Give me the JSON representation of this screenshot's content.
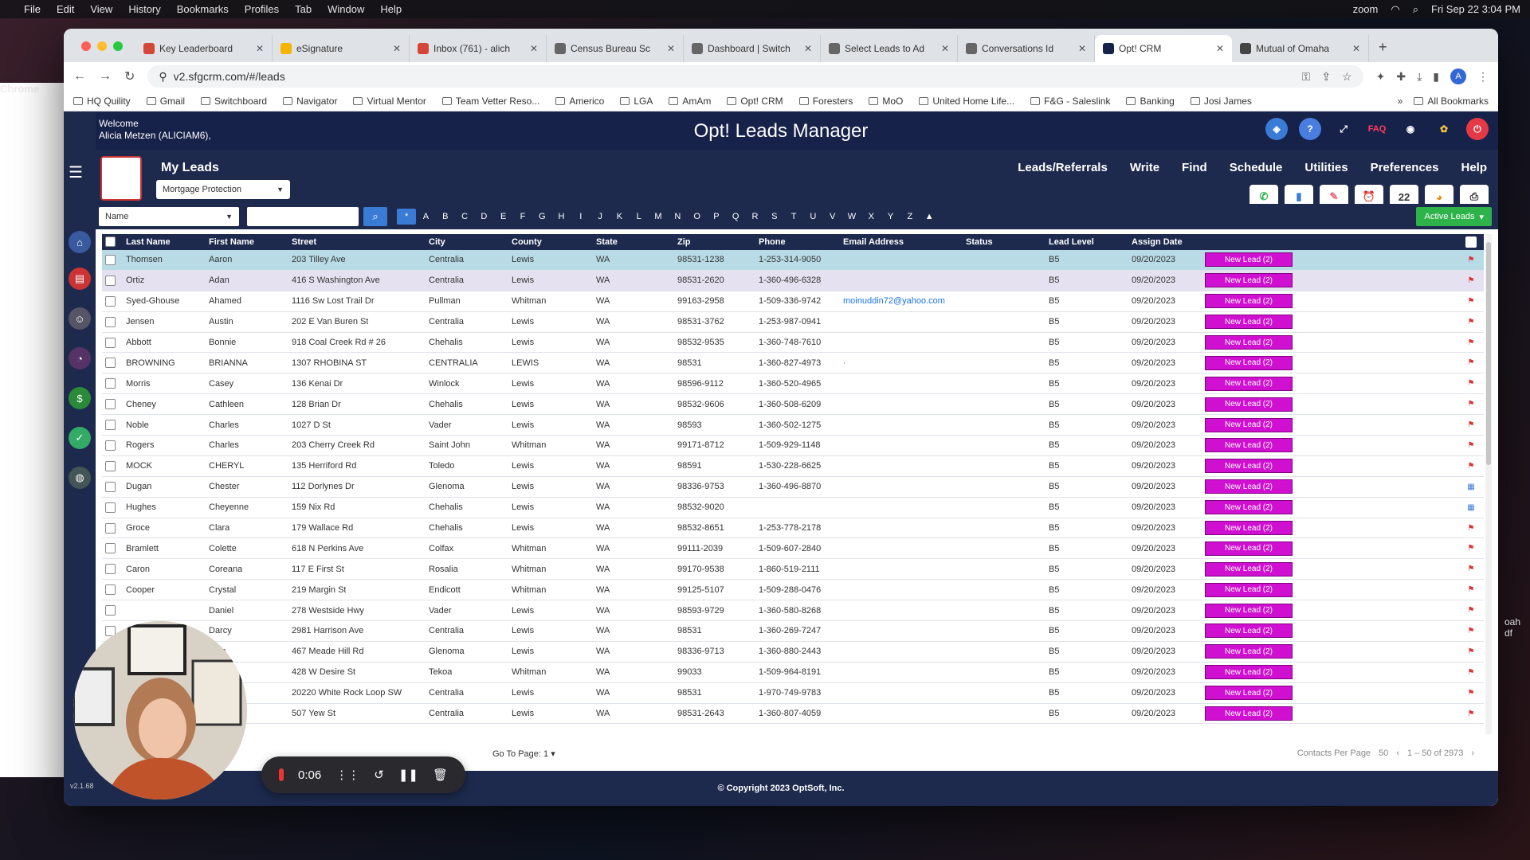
{
  "macos": {
    "app": "Chrome",
    "menu": [
      "File",
      "Edit",
      "View",
      "History",
      "Bookmarks",
      "Profiles",
      "Tab",
      "Window",
      "Help"
    ],
    "right": {
      "zoom": "zoom",
      "datetime": "Fri Sep 22  3:04 PM"
    }
  },
  "browser": {
    "tabs": [
      {
        "title": "Key Leaderboard",
        "fav": "gmail-icon",
        "color": "#d44638"
      },
      {
        "title": "eSignature",
        "fav": "doc-icon",
        "color": "#f4b400"
      },
      {
        "title": "Inbox (761) - alich",
        "fav": "gmail-icon",
        "color": "#d44638"
      },
      {
        "title": "Census Bureau Sc",
        "fav": "globe-icon",
        "color": "#666666"
      },
      {
        "title": "Dashboard | Switch",
        "fav": "globe-icon",
        "color": "#666666"
      },
      {
        "title": "Select Leads to Ad",
        "fav": "globe-icon",
        "color": "#666666"
      },
      {
        "title": "Conversations Id",
        "fav": "globe-icon",
        "color": "#666666"
      },
      {
        "title": "Opt! CRM",
        "fav": "optcrm-icon",
        "color": "#17224a",
        "active": true
      },
      {
        "title": "Mutual of Omaha",
        "fav": "globe-icon",
        "color": "#444444"
      }
    ],
    "url": "v2.sfgcrm.com/#/leads",
    "bookmarks": [
      "HQ Quility",
      "Gmail",
      "Switchboard",
      "Navigator",
      "Virtual Mentor",
      "Team Vetter Reso...",
      "Americo",
      "LGA",
      "AmAm",
      "Opt! CRM",
      "Foresters",
      "MoO",
      "United Home Life...",
      "F&G - Saleslink",
      "Banking",
      "Josi James"
    ],
    "all_bookmarks": "All Bookmarks"
  },
  "app": {
    "welcome_line1": "Welcome",
    "welcome_line2": "Alicia Metzen (ALICIAM6),",
    "title": "Opt! Leads Manager",
    "section_title": "My Leads",
    "lead_type": "Mortgage Protection",
    "nav": [
      "Leads/Referrals",
      "Write",
      "Find",
      "Schedule",
      "Utilities",
      "Preferences",
      "Help"
    ],
    "header_icons": [
      "map-icon",
      "help-icon",
      "fullscreen-icon",
      "faq-icon",
      "camera-icon",
      "flower-icon",
      "power-icon"
    ],
    "faq_label": "FAQ",
    "calendar_day": "22",
    "search_field": "Name",
    "alphabet": [
      "*",
      "A",
      "B",
      "C",
      "D",
      "E",
      "F",
      "G",
      "H",
      "I",
      "J",
      "K",
      "L",
      "M",
      "N",
      "O",
      "P",
      "Q",
      "R",
      "S",
      "T",
      "U",
      "V",
      "W",
      "X",
      "Y",
      "Z",
      "▲"
    ],
    "active_leads": "Active Leads",
    "columns": [
      "Last Name",
      "First Name",
      "Street",
      "City",
      "County",
      "State",
      "Zip",
      "Phone",
      "Email Address",
      "Status",
      "Lead Level",
      "Assign Date"
    ],
    "rows": [
      [
        "Thomsen",
        "Aaron",
        "203 Tilley Ave",
        "Centralia",
        "Lewis",
        "WA",
        "98531-1238",
        "1-253-314-9050",
        "",
        "New Lead (2)",
        "B5",
        "09/20/2023"
      ],
      [
        "Ortiz",
        "Adan",
        "416 S Washington Ave",
        "Centralia",
        "Lewis",
        "WA",
        "98531-2620",
        "1-360-496-6328",
        "",
        "New Lead (2)",
        "B5",
        "09/20/2023"
      ],
      [
        "Syed-Ghouse",
        "Ahamed",
        "1116 Sw Lost Trail Dr",
        "Pullman",
        "Whitman",
        "WA",
        "99163-2958",
        "1-509-336-9742",
        "moinuddin72@yahoo.com",
        "New Lead (2)",
        "B5",
        "09/20/2023"
      ],
      [
        "Jensen",
        "Austin",
        "202 E Van Buren St",
        "Centralia",
        "Lewis",
        "WA",
        "98531-3762",
        "1-253-987-0941",
        "",
        "New Lead (2)",
        "B5",
        "09/20/2023"
      ],
      [
        "Abbott",
        "Bonnie",
        "918 Coal Creek Rd # 26",
        "Chehalis",
        "Lewis",
        "WA",
        "98532-9535",
        "1-360-748-7610",
        "",
        "New Lead (2)",
        "B5",
        "09/20/2023"
      ],
      [
        "BROWNING",
        "BRIANNA",
        "1307 RHOBINA ST",
        "CENTRALIA",
        "LEWIS",
        "WA",
        "98531",
        "1-360-827-4973",
        "·",
        "New Lead (2)",
        "B5",
        "09/20/2023"
      ],
      [
        "Morris",
        "Casey",
        "136 Kenai Dr",
        "Winlock",
        "Lewis",
        "WA",
        "98596-9112",
        "1-360-520-4965",
        "",
        "New Lead (2)",
        "B5",
        "09/20/2023"
      ],
      [
        "Cheney",
        "Cathleen",
        "128 Brian Dr",
        "Chehalis",
        "Lewis",
        "WA",
        "98532-9606",
        "1-360-508-6209",
        "",
        "New Lead (2)",
        "B5",
        "09/20/2023"
      ],
      [
        "Noble",
        "Charles",
        "1027 D St",
        "Vader",
        "Lewis",
        "WA",
        "98593",
        "1-360-502-1275",
        "",
        "New Lead (2)",
        "B5",
        "09/20/2023"
      ],
      [
        "Rogers",
        "Charles",
        "203 Cherry Creek Rd",
        "Saint John",
        "Whitman",
        "WA",
        "99171-8712",
        "1-509-929-1148",
        "",
        "New Lead (2)",
        "B5",
        "09/20/2023"
      ],
      [
        "MOCK",
        "CHERYL",
        "135 Herriford Rd",
        "Toledo",
        "Lewis",
        "WA",
        "98591",
        "1-530-228-6625",
        "",
        "New Lead (2)",
        "B5",
        "09/20/2023"
      ],
      [
        "Dugan",
        "Chester",
        "112 Dorlynes Dr",
        "Glenoma",
        "Lewis",
        "WA",
        "98336-9753",
        "1-360-496-8870",
        "",
        "New Lead (2)",
        "B5",
        "09/20/2023"
      ],
      [
        "Hughes",
        "Cheyenne",
        "159 Nix Rd",
        "Chehalis",
        "Lewis",
        "WA",
        "98532-9020",
        "",
        "",
        "New Lead (2)",
        "B5",
        "09/20/2023"
      ],
      [
        "Groce",
        "Clara",
        "179 Wallace Rd",
        "Chehalis",
        "Lewis",
        "WA",
        "98532-8651",
        "1-253-778-2178",
        "",
        "New Lead (2)",
        "B5",
        "09/20/2023"
      ],
      [
        "Bramlett",
        "Colette",
        "618 N Perkins Ave",
        "Colfax",
        "Whitman",
        "WA",
        "99111-2039",
        "1-509-607-2840",
        "",
        "New Lead (2)",
        "B5",
        "09/20/2023"
      ],
      [
        "Caron",
        "Coreana",
        "117 E First St",
        "Rosalia",
        "Whitman",
        "WA",
        "99170-9538",
        "1-860-519-2111",
        "",
        "New Lead (2)",
        "B5",
        "09/20/2023"
      ],
      [
        "Cooper",
        "Crystal",
        "219 Margin St",
        "Endicott",
        "Whitman",
        "WA",
        "99125-5107",
        "1-509-288-0476",
        "",
        "New Lead (2)",
        "B5",
        "09/20/2023"
      ],
      [
        "",
        "Daniel",
        "278 Westside Hwy",
        "Vader",
        "Lewis",
        "WA",
        "98593-9729",
        "1-360-580-8268",
        "",
        "New Lead (2)",
        "B5",
        "09/20/2023"
      ],
      [
        "",
        "Darcy",
        "2981 Harrison Ave",
        "Centralia",
        "Lewis",
        "WA",
        "98531",
        "1-360-269-7247",
        "",
        "New Lead (2)",
        "B5",
        "09/20/2023"
      ],
      [
        "",
        "aryn",
        "467 Meade Hill Rd",
        "Glenoma",
        "Lewis",
        "WA",
        "98336-9713",
        "1-360-880-2443",
        "",
        "New Lead (2)",
        "B5",
        "09/20/2023"
      ],
      [
        "",
        "vid",
        "428 W Desire St",
        "Tekoa",
        "Whitman",
        "WA",
        "99033",
        "1-509-964-8191",
        "",
        "New Lead (2)",
        "B5",
        "09/20/2023"
      ],
      [
        "",
        "vid",
        "20220 White Rock Loop SW",
        "Centralia",
        "Lewis",
        "WA",
        "98531",
        "1-970-749-9783",
        "",
        "New Lead (2)",
        "B5",
        "09/20/2023"
      ],
      [
        "",
        "an",
        "507 Yew St",
        "Centralia",
        "Lewis",
        "WA",
        "98531-2643",
        "1-360-807-4059",
        "",
        "New Lead (2)",
        "B5",
        "09/20/2023"
      ]
    ],
    "side_icons": [
      "flag",
      "flag",
      "flag",
      "flag",
      "flag",
      "flag",
      "flag",
      "flag",
      "flag",
      "flag",
      "flag",
      "gift",
      "gift",
      "flag",
      "flag",
      "flag",
      "flag",
      "flag",
      "flag",
      "flag",
      "flag",
      "flag",
      "flag"
    ],
    "goto_label": "Go To Page:",
    "goto_page": "1",
    "contacts_per_page_label": "Contacts Per Page",
    "contacts_per_page": "50",
    "range": "1 – 50 of 2973",
    "copyright": "© Copyright 2023  OptSoft, Inc.",
    "version": "v2.1.68"
  },
  "recorder": {
    "time": "0:06"
  },
  "overlay_text": "oah\ndf",
  "colors": {
    "navy": "#1d2a4e",
    "status": "#d010d0",
    "accent": "#3a7bd5",
    "green": "#2db34a"
  }
}
